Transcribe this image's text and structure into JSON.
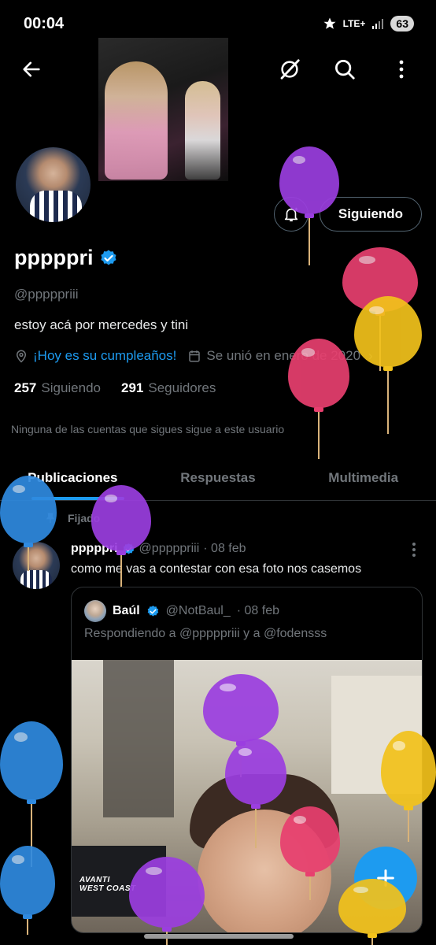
{
  "status_bar": {
    "time": "00:04",
    "network": "LTE+",
    "battery": "63"
  },
  "profile": {
    "name": "pppppri",
    "handle": "@pppppriii",
    "bio": "estoy acá por mercedes y tini",
    "birthday": "¡Hoy es su cumpleaños!",
    "joined": "Se unió en enero de 2020",
    "following_count": "257",
    "following_label": "Siguiendo",
    "followers_count": "291",
    "followers_label": "Seguidores",
    "mutual_note": "Ninguna de las cuentas que sigues sigue a este usuario",
    "follow_button": "Siguiendo"
  },
  "tabs": [
    {
      "label": "Publicaciones",
      "active": true
    },
    {
      "label": "Respuestas",
      "active": false
    },
    {
      "label": "Multimedia",
      "active": false
    }
  ],
  "post": {
    "pinned_label": "Fijado",
    "author_name": "pppppri",
    "author_handle": "@pppppriii",
    "date": "· 08 feb",
    "text": "como me vas a contestar con esa foto nos casemos",
    "quote": {
      "author_name": "Baúl",
      "author_handle": "@NotBaul_",
      "date": "· 08 feb",
      "reply_to": "Respondiendo a @pppppriii y a @fodensss",
      "image_text": "AVANTI\nWEST COAST"
    }
  },
  "colors": {
    "accent": "#1d9bf0",
    "background": "#000000",
    "muted": "#71767b"
  },
  "icons": [
    "back-arrow-icon",
    "grok-icon",
    "search-icon",
    "more-icon",
    "bell-icon",
    "verified-icon",
    "location-icon",
    "calendar-icon",
    "pin-icon",
    "compose-plus-icon"
  ]
}
